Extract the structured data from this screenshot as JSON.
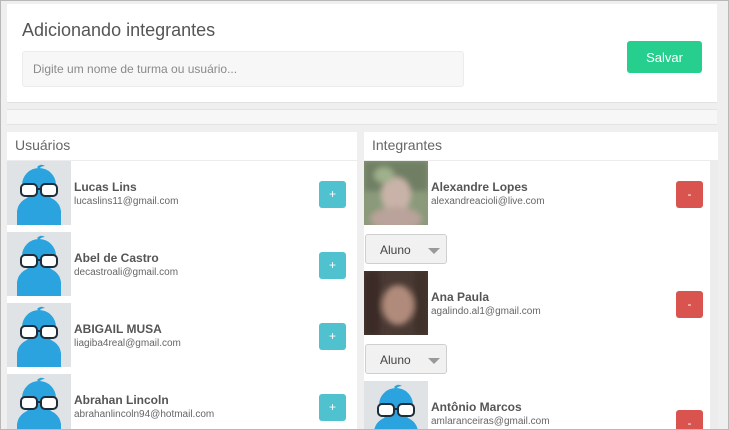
{
  "header": {
    "title": "Adicionando integrantes",
    "search_placeholder": "Digite um nome de turma ou usuário...",
    "save_label": "Salvar"
  },
  "colors": {
    "save": "#26cf8e",
    "add": "#4fc1cf",
    "remove": "#d9534f",
    "avatar_blue": "#2aa3de"
  },
  "users_panel": {
    "title": "Usuários",
    "add_label": "+",
    "items": [
      {
        "name": "Lucas Lins",
        "email": "lucaslins11@gmail.com",
        "avatar": "default-avatar-icon"
      },
      {
        "name": "Abel de Castro",
        "email": "decastroali@gmail.com",
        "avatar": "default-avatar-icon"
      },
      {
        "name": "ABIGAIL MUSA",
        "email": "liagiba4real@gmail.com",
        "avatar": "default-avatar-icon"
      },
      {
        "name": "Abrahan Lincoln",
        "email": "abrahanlincoln94@hotmail.com",
        "avatar": "default-avatar-icon"
      }
    ]
  },
  "members_panel": {
    "title": "Integrantes",
    "remove_label": "-",
    "items": [
      {
        "name": "Alexandre Lopes",
        "email": "alexandreacioli@live.com",
        "avatar": "photo-blurred",
        "role": "Aluno"
      },
      {
        "name": "Ana Paula",
        "email": "agalindo.al1@gmail.com",
        "avatar": "photo-blurred",
        "role": "Aluno"
      },
      {
        "name": "Antônio Marcos",
        "email": "amlaranceiras@gmail.com",
        "avatar": "default-avatar-icon",
        "role": ""
      }
    ]
  }
}
